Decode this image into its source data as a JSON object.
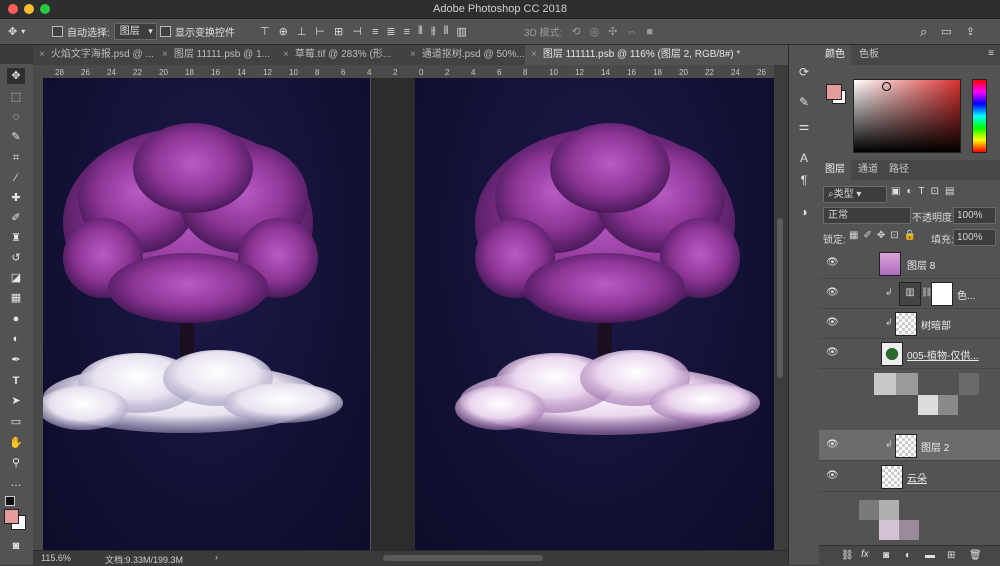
{
  "app": {
    "title": "Adobe Photoshop CC 2018",
    "traffic_lights": [
      "#ff5f57",
      "#febc2e",
      "#28c840"
    ]
  },
  "options_bar": {
    "auto_select_label": "自动选择:",
    "auto_select_target": "图层",
    "show_transform_label": "显示变换控件",
    "mode_3d_label": "3D 模式:"
  },
  "tabs": [
    {
      "label": "火焰文字海报.psd @ ...",
      "active": false
    },
    {
      "label": "图层 11111.psb @ 1...",
      "active": false
    },
    {
      "label": "草莓.tif @ 283% (形...",
      "active": false
    },
    {
      "label": "通道抠树.psd @ 50%...",
      "active": false
    },
    {
      "label": "图层 111111.psb @ 116% (图层 2, RGB/8#) *",
      "active": true
    }
  ],
  "ruler_ticks": [
    "28",
    "26",
    "24",
    "22",
    "20",
    "18",
    "16",
    "14",
    "12",
    "10",
    "8",
    "6",
    "4",
    "2",
    "0",
    "2",
    "4",
    "6",
    "8",
    "10",
    "12",
    "14",
    "16",
    "18",
    "20",
    "22",
    "24",
    "26",
    "28"
  ],
  "status": {
    "zoom": "115.6%",
    "doc_info": "文档:9.33M/199.3M"
  },
  "panels": {
    "color": {
      "tab_color": "颜色",
      "tab_swatches": "色板",
      "foreground": "#e39b9b",
      "background": "#ffffff",
      "hue": "#d93030"
    },
    "layers": {
      "tab_layers": "图层",
      "tab_channels": "通道",
      "tab_paths": "路径",
      "filter_kind": "类型",
      "blend_mode": "正常",
      "opacity_label": "不透明度:",
      "opacity_value": "100%",
      "lock_label": "锁定:",
      "fill_label": "填充:",
      "fill_value": "100%",
      "items": [
        {
          "name": "图层 8",
          "selected": false
        },
        {
          "name": "色...",
          "selected": false
        },
        {
          "name": "树暗部",
          "selected": false
        },
        {
          "name": "005-植物-仅供...",
          "selected": false
        },
        {
          "name": "图层 2",
          "selected": true
        },
        {
          "name": "云朵",
          "selected": false
        }
      ]
    }
  },
  "colors": {
    "panel_bg": "#535353",
    "canvas_bg": "#2a2a2a",
    "doc_bg": "#131236",
    "tree_purple": "#9b3fa8",
    "cloud": "#f2eef7"
  }
}
